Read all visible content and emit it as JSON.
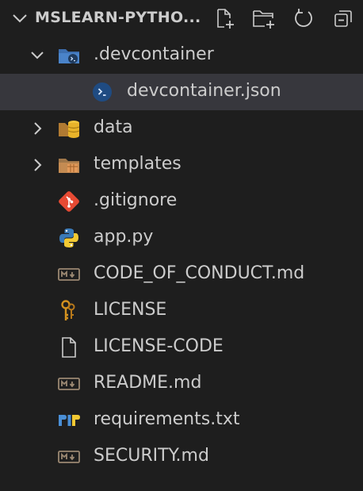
{
  "explorer": {
    "title": "MSLEARN-PYTHO...",
    "actions": [
      "new-file-icon",
      "new-folder-icon",
      "refresh-icon",
      "collapse-all-icon"
    ]
  },
  "tree": [
    {
      "label": ".devcontainer",
      "type": "folder",
      "expanded": true,
      "icon": "devcontainer-folder-icon"
    },
    {
      "label": "devcontainer.json",
      "type": "file",
      "selected": true,
      "icon": "devcontainer-icon"
    },
    {
      "label": "data",
      "type": "folder",
      "expanded": false,
      "icon": "database-folder-icon"
    },
    {
      "label": "templates",
      "type": "folder",
      "expanded": false,
      "icon": "templates-folder-icon"
    },
    {
      "label": ".gitignore",
      "type": "file",
      "icon": "git-icon"
    },
    {
      "label": "app.py",
      "type": "file",
      "icon": "python-icon"
    },
    {
      "label": "CODE_OF_CONDUCT.md",
      "type": "file",
      "icon": "markdown-icon"
    },
    {
      "label": "LICENSE",
      "type": "file",
      "icon": "license-key-icon"
    },
    {
      "label": "LICENSE-CODE",
      "type": "file",
      "icon": "generic-file-icon"
    },
    {
      "label": "README.md",
      "type": "file",
      "icon": "markdown-icon"
    },
    {
      "label": "requirements.txt",
      "type": "file",
      "icon": "pip-icon"
    },
    {
      "label": "SECURITY.md",
      "type": "file",
      "icon": "markdown-icon"
    }
  ],
  "colors": {
    "background": "#1e1e1e",
    "selected_row": "#37373d",
    "text": "#cccccc",
    "folder_blue": "#3d6fb0",
    "database_yellow": "#e8b32a",
    "git_red": "#e64a33",
    "python_blue": "#3a7ab8",
    "python_yellow": "#f2c933",
    "markdown": "#9b8872",
    "key_gold": "#d4921f"
  }
}
